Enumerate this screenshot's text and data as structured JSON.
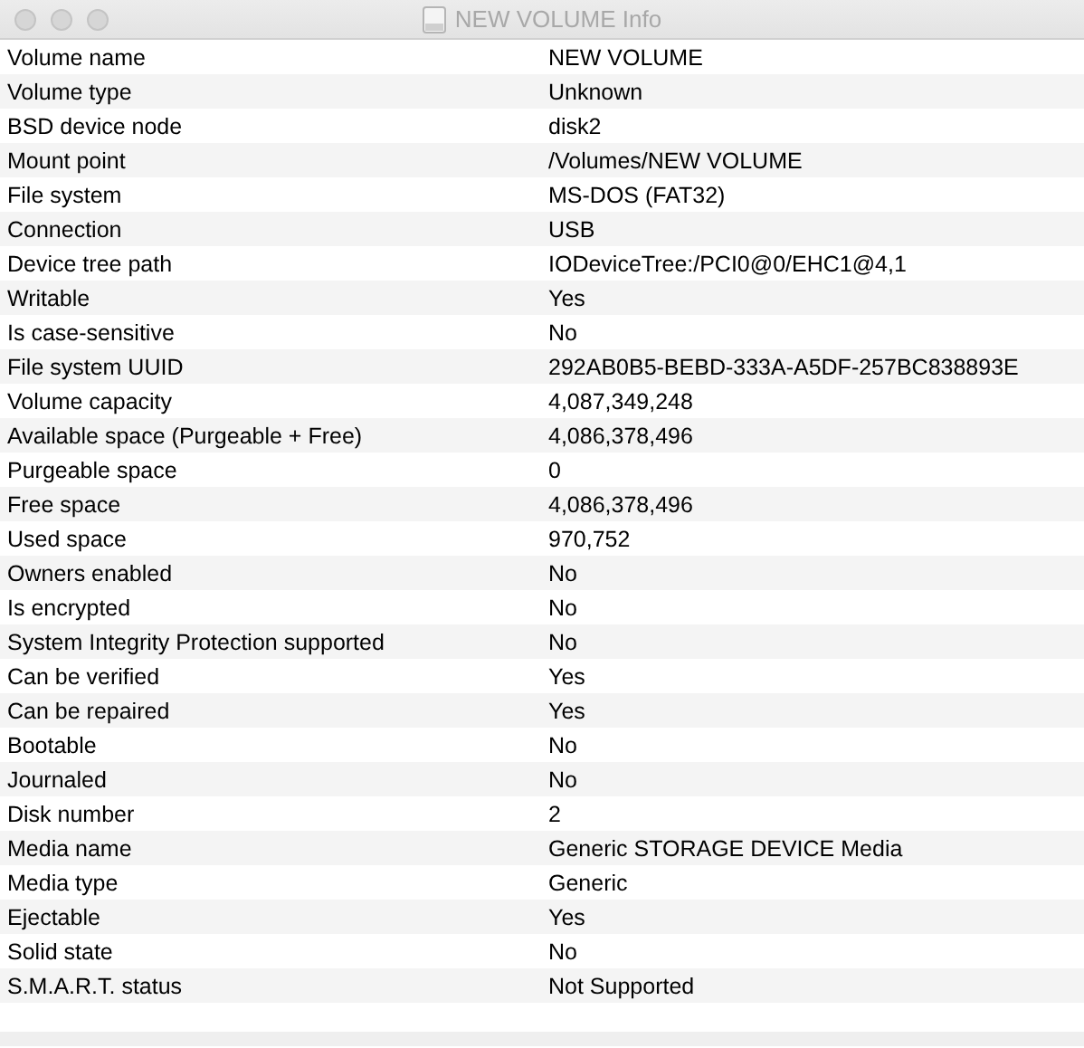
{
  "window": {
    "title": "NEW VOLUME Info"
  },
  "rows": [
    {
      "label": "Volume name",
      "value": "NEW VOLUME"
    },
    {
      "label": "Volume type",
      "value": "Unknown"
    },
    {
      "label": "BSD device node",
      "value": "disk2"
    },
    {
      "label": "Mount point",
      "value": "/Volumes/NEW VOLUME"
    },
    {
      "label": "File system",
      "value": "MS-DOS (FAT32)"
    },
    {
      "label": "Connection",
      "value": "USB"
    },
    {
      "label": "Device tree path",
      "value": "IODeviceTree:/PCI0@0/EHC1@4,1"
    },
    {
      "label": "Writable",
      "value": "Yes"
    },
    {
      "label": "Is case-sensitive",
      "value": "No"
    },
    {
      "label": "File system UUID",
      "value": "292AB0B5-BEBD-333A-A5DF-257BC838893E"
    },
    {
      "label": "Volume capacity",
      "value": "4,087,349,248"
    },
    {
      "label": "Available space (Purgeable + Free)",
      "value": "4,086,378,496"
    },
    {
      "label": "Purgeable space",
      "value": "0"
    },
    {
      "label": "Free space",
      "value": "4,086,378,496"
    },
    {
      "label": "Used space",
      "value": "970,752"
    },
    {
      "label": "Owners enabled",
      "value": "No"
    },
    {
      "label": "Is encrypted",
      "value": "No"
    },
    {
      "label": "System Integrity Protection supported",
      "value": "No"
    },
    {
      "label": "Can be verified",
      "value": "Yes"
    },
    {
      "label": "Can be repaired",
      "value": "Yes"
    },
    {
      "label": "Bootable",
      "value": "No"
    },
    {
      "label": "Journaled",
      "value": "No"
    },
    {
      "label": "Disk number",
      "value": "2"
    },
    {
      "label": "Media name",
      "value": "Generic STORAGE DEVICE Media"
    },
    {
      "label": "Media type",
      "value": "Generic"
    },
    {
      "label": "Ejectable",
      "value": "Yes"
    },
    {
      "label": "Solid state",
      "value": "No"
    },
    {
      "label": "S.M.A.R.T. status",
      "value": "Not Supported"
    }
  ]
}
